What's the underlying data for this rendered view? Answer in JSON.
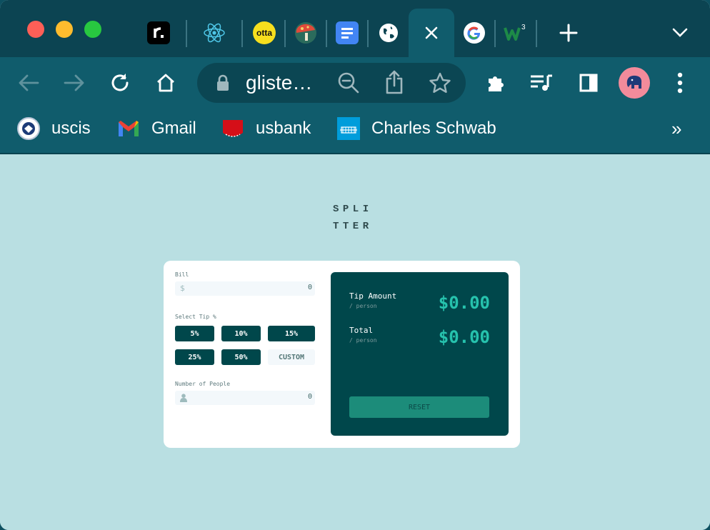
{
  "browser": {
    "tabs": [
      {
        "name": "readwise",
        "icon": "r-logo"
      },
      {
        "name": "react",
        "icon": "react-logo"
      },
      {
        "name": "otta",
        "icon": "otta-logo",
        "text": "otta"
      },
      {
        "name": "mushroom",
        "icon": "mushroom-logo"
      },
      {
        "name": "docs",
        "icon": "docs-logo"
      },
      {
        "name": "globe",
        "icon": "globe-icon"
      },
      {
        "name": "active",
        "icon": "close-icon"
      },
      {
        "name": "google",
        "icon": "google-logo"
      },
      {
        "name": "w3c",
        "icon": "w3-logo"
      }
    ],
    "address": "gliste…",
    "bookmarks": [
      {
        "label": "uscis",
        "icon": "dhs-seal-icon"
      },
      {
        "label": "Gmail",
        "icon": "gmail-icon"
      },
      {
        "label": "usbank",
        "icon": "usbank-icon"
      },
      {
        "label": "Charles Schwab",
        "icon": "schwab-icon"
      }
    ],
    "more_bookmarks": "»"
  },
  "app": {
    "logo_line1": "SPLI",
    "logo_line2": "TTER",
    "bill_label": "Bill",
    "bill_icon": "$",
    "bill_value": "0",
    "tip_label": "Select Tip %",
    "tips": [
      "5%",
      "10%",
      "15%",
      "25%",
      "50%"
    ],
    "custom_label": "CUSTOM",
    "people_label": "Number of People",
    "people_value": "0",
    "tip_amount_label": "Tip Amount",
    "tip_amount_sub": "/ person",
    "tip_amount_value": "$0.00",
    "total_label": "Total",
    "total_sub": "/ person",
    "total_value": "$0.00",
    "reset_label": "RESET"
  },
  "colors": {
    "page_bg": "#b9dfe2",
    "dark_green": "#00474b",
    "accent": "#26c2ad",
    "reset_bg": "#1c8c7a",
    "chrome": "#105c6c"
  }
}
